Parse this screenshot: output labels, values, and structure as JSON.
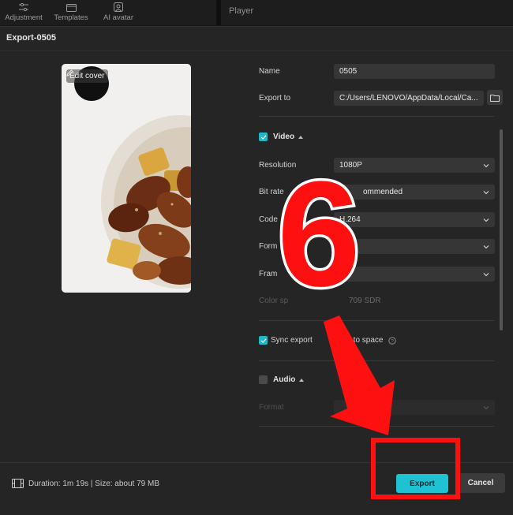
{
  "toolbar": {
    "items": [
      {
        "label": "Adjustment",
        "icon": "sliders-icon"
      },
      {
        "label": "Templates",
        "icon": "templates-icon"
      },
      {
        "label": "AI avatar",
        "icon": "avatar-icon"
      }
    ],
    "player_label": "Player"
  },
  "dialog": {
    "title": "Export-0505",
    "edit_cover_label": "Edit cover"
  },
  "form": {
    "name_label": "Name",
    "name_value": "0505",
    "export_to_label": "Export to",
    "export_to_value": "C:/Users/LENOVO/AppData/Local/Ca...",
    "video": {
      "section_label": "Video",
      "checked": true,
      "resolution_label": "Resolution",
      "resolution_value": "1080P",
      "bitrate_label": "Bit rate",
      "bitrate_value": "ommended",
      "codec_label": "Code",
      "codec_value": "H.264",
      "format_label": "Form",
      "format_value": "",
      "framerate_label": "Fram",
      "framerate_value": "",
      "color_space_label": "Color sp",
      "color_space_value": "709 SDR"
    },
    "sync_label": "Sync export",
    "sync_label_tail": "videos to space",
    "sync_checked": true,
    "audio": {
      "section_label": "Audio",
      "checked": false,
      "format_label": "Format"
    }
  },
  "footer": {
    "duration_text": "Duration: 1m 19s | Size: about 79 MB",
    "export_button": "Export",
    "cancel_button": "Cancel"
  },
  "annotation": {
    "step_number": "6"
  },
  "colors": {
    "accent": "#1fc2d3",
    "highlight": "#ff1010",
    "dialog_bg": "#252525"
  }
}
